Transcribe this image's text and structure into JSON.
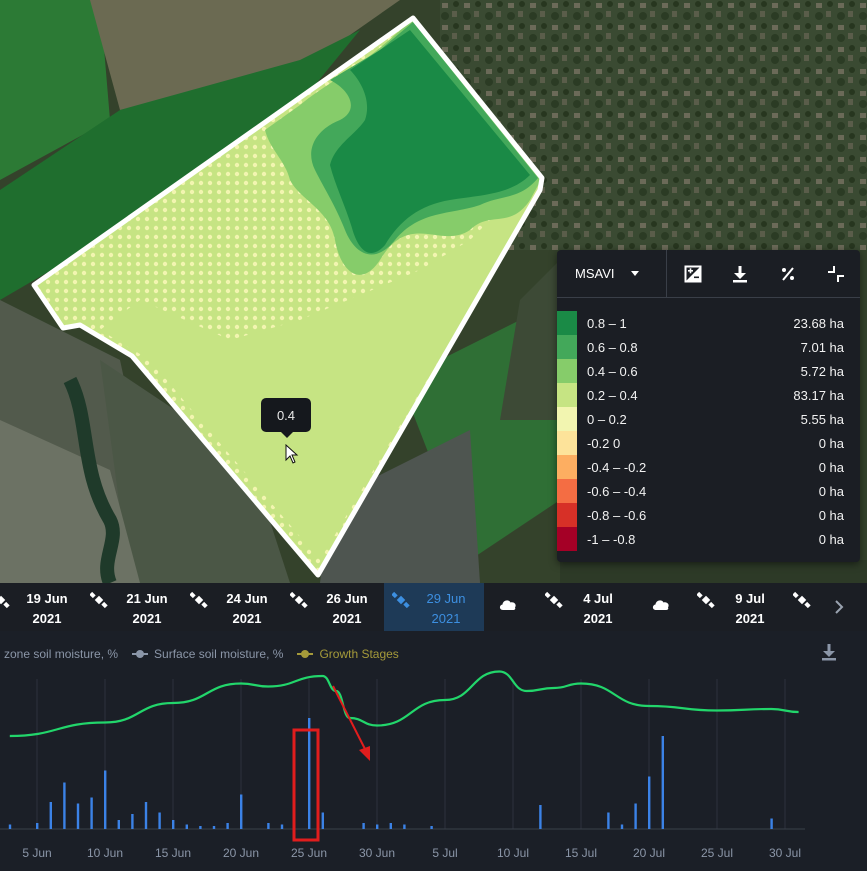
{
  "map": {
    "tooltip_value": "0.4"
  },
  "legend": {
    "index_label": "MSAVI",
    "tools": [
      "contrast-icon",
      "download-icon",
      "percent-icon",
      "collapse-icon"
    ],
    "rows": [
      {
        "range": "0.8 – 1",
        "area": "23.68 ha",
        "color": "#1a8a46"
      },
      {
        "range": "0.6 – 0.8",
        "area": "7.01 ha",
        "color": "#43a85a"
      },
      {
        "range": "0.4 – 0.6",
        "area": "5.72 ha",
        "color": "#86cc6a"
      },
      {
        "range": "0.2 – 0.4",
        "area": "83.17 ha",
        "color": "#c6e483"
      },
      {
        "range": "0 – 0.2",
        "area": "5.55 ha",
        "color": "#f2f5b0"
      },
      {
        "range": "-0.2 0",
        "area": "0 ha",
        "color": "#fde39a"
      },
      {
        "range": "-0.4 – -0.2",
        "area": "0 ha",
        "color": "#fdae61"
      },
      {
        "range": "-0.6 – -0.4",
        "area": "0 ha",
        "color": "#f46d43"
      },
      {
        "range": "-0.8 – -0.6",
        "area": "0 ha",
        "color": "#d73027"
      },
      {
        "range": "-1 – -0.8",
        "area": "0 ha",
        "color": "#a50026"
      }
    ]
  },
  "dates": {
    "items": [
      {
        "day": "19 Jun",
        "year": "2021",
        "active": false
      },
      {
        "day": "21 Jun",
        "year": "2021",
        "active": false
      },
      {
        "day": "24 Jun",
        "year": "2021",
        "active": false
      },
      {
        "day": "26 Jun",
        "year": "2021",
        "active": false
      },
      {
        "day": "29 Jun",
        "year": "2021",
        "active": true
      },
      {
        "day": "4 Jul",
        "year": "2021",
        "active": false
      },
      {
        "day": "9 Jul",
        "year": "2021",
        "active": false
      }
    ]
  },
  "chart": {
    "legend": [
      {
        "label": "zone soil moisture, %",
        "color": "#8b96a8"
      },
      {
        "label": "Surface soil moisture, %",
        "color": "#8b96a8"
      },
      {
        "label": "Growth Stages",
        "color": "#a59a3a"
      }
    ]
  },
  "chart_data": {
    "type": "line",
    "x_ticks": [
      "5 Jun",
      "10 Jun",
      "15 Jun",
      "20 Jun",
      "25 Jun",
      "30 Jun",
      "5 Jul",
      "10 Jul",
      "15 Jul",
      "20 Jul",
      "25 Jul",
      "30 Jul"
    ],
    "line_color": "#22d66b",
    "bar_color": "#3b82e6",
    "series": [
      {
        "type": "line",
        "points": [
          {
            "x": "3 Jun",
            "y": 0.62
          },
          {
            "x": "10 Jun",
            "y": 0.71
          },
          {
            "x": "15 Jun",
            "y": 0.84
          },
          {
            "x": "20 Jun",
            "y": 0.97
          },
          {
            "x": "22 Jun",
            "y": 0.95
          },
          {
            "x": "26 Jun",
            "y": 1.02
          },
          {
            "x": "27 Jun",
            "y": 0.92
          },
          {
            "x": "28 Jun",
            "y": 0.74
          },
          {
            "x": "30 Jun",
            "y": 0.69
          },
          {
            "x": "5 Jul",
            "y": 0.86
          },
          {
            "x": "9 Jul",
            "y": 1.05
          },
          {
            "x": "11 Jul",
            "y": 0.92
          },
          {
            "x": "13 Jul",
            "y": 0.94
          },
          {
            "x": "15 Jul",
            "y": 0.97
          },
          {
            "x": "20 Jul",
            "y": 0.82
          },
          {
            "x": "25 Jul",
            "y": 0.79
          },
          {
            "x": "29 Jul",
            "y": 0.8
          },
          {
            "x": "31 Jul",
            "y": 0.78
          }
        ]
      },
      {
        "type": "bar",
        "points": [
          {
            "x": "3 Jun",
            "y": 0.03
          },
          {
            "x": "5 Jun",
            "y": 0.04
          },
          {
            "x": "6 Jun",
            "y": 0.18
          },
          {
            "x": "7 Jun",
            "y": 0.31
          },
          {
            "x": "8 Jun",
            "y": 0.17
          },
          {
            "x": "9 Jun",
            "y": 0.21
          },
          {
            "x": "10 Jun",
            "y": 0.39
          },
          {
            "x": "11 Jun",
            "y": 0.06
          },
          {
            "x": "12 Jun",
            "y": 0.1
          },
          {
            "x": "13 Jun",
            "y": 0.18
          },
          {
            "x": "14 Jun",
            "y": 0.11
          },
          {
            "x": "15 Jun",
            "y": 0.06
          },
          {
            "x": "16 Jun",
            "y": 0.03
          },
          {
            "x": "17 Jun",
            "y": 0.02
          },
          {
            "x": "18 Jun",
            "y": 0.02
          },
          {
            "x": "19 Jun",
            "y": 0.04
          },
          {
            "x": "20 Jun",
            "y": 0.23
          },
          {
            "x": "22 Jun",
            "y": 0.04
          },
          {
            "x": "23 Jun",
            "y": 0.03
          },
          {
            "x": "25 Jun",
            "y": 0.74
          },
          {
            "x": "26 Jun",
            "y": 0.11
          },
          {
            "x": "29 Jun",
            "y": 0.04
          },
          {
            "x": "30 Jun",
            "y": 0.03
          },
          {
            "x": "1 Jul",
            "y": 0.04
          },
          {
            "x": "2 Jul",
            "y": 0.03
          },
          {
            "x": "4 Jul",
            "y": 0.02
          },
          {
            "x": "12 Jul",
            "y": 0.16
          },
          {
            "x": "17 Jul",
            "y": 0.11
          },
          {
            "x": "18 Jul",
            "y": 0.03
          },
          {
            "x": "19 Jul",
            "y": 0.17
          },
          {
            "x": "20 Jul",
            "y": 0.35
          },
          {
            "x": "21 Jul",
            "y": 0.62
          },
          {
            "x": "29 Jul",
            "y": 0.07
          }
        ]
      }
    ],
    "grid": true,
    "annotations": [
      "red-box-25-jun",
      "red-arrow-to-dip"
    ]
  }
}
